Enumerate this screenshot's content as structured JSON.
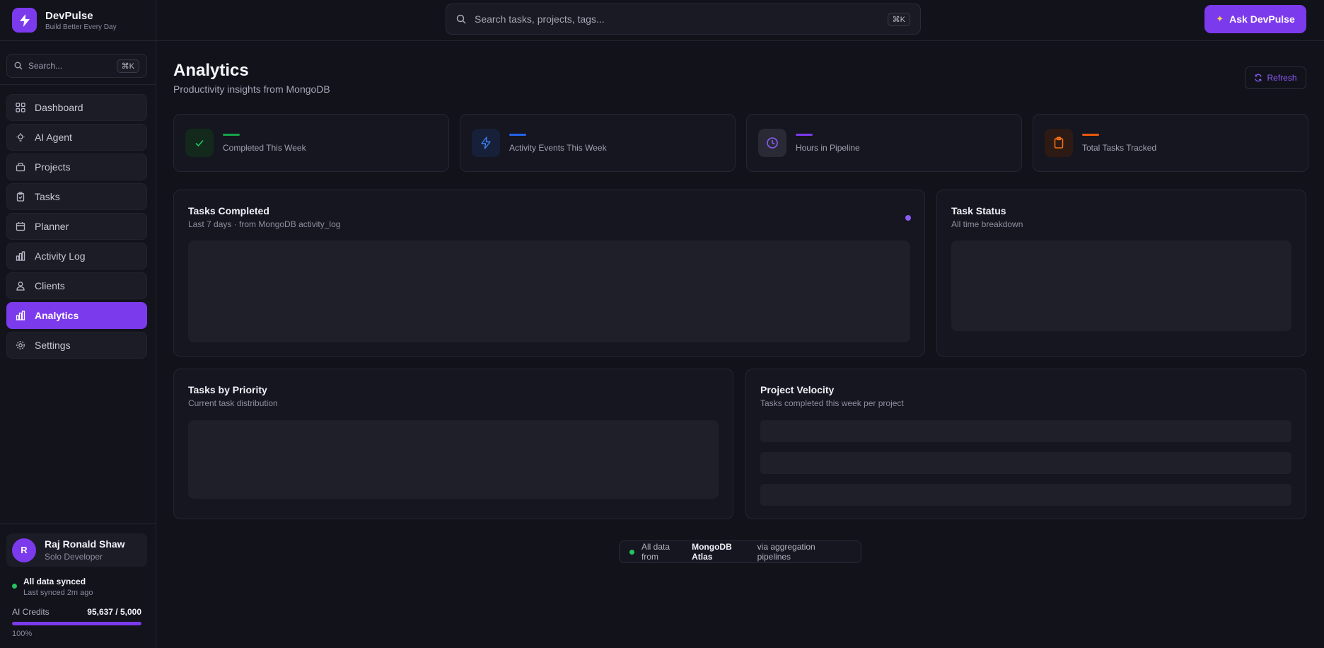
{
  "brand": {
    "name": "DevPulse",
    "tagline": "Build Better Every Day"
  },
  "sidebar": {
    "search_placeholder": "Search...",
    "search_shortcut": "⌘K",
    "items": [
      {
        "label": "Dashboard",
        "icon": "grid-icon"
      },
      {
        "label": "AI Agent",
        "icon": "bulb-icon"
      },
      {
        "label": "Projects",
        "icon": "folder-icon"
      },
      {
        "label": "Tasks",
        "icon": "clipboard-icon"
      },
      {
        "label": "Planner",
        "icon": "calendar-icon"
      },
      {
        "label": "Activity Log",
        "icon": "bar-chart-icon"
      },
      {
        "label": "Clients",
        "icon": "user-icon"
      },
      {
        "label": "Analytics",
        "icon": "bar-chart-icon",
        "active": true
      },
      {
        "label": "Settings",
        "icon": "gear-icon"
      }
    ],
    "user": {
      "initial": "R",
      "name": "Raj Ronald Shaw",
      "role": "Solo Developer"
    },
    "sync": {
      "title": "All data synced",
      "subtitle": "Last synced 2m ago"
    },
    "credits": {
      "label": "AI Credits",
      "value": "95,637 / 5,000",
      "percent_text": "100%",
      "fill_fraction": 1.0
    }
  },
  "topbar": {
    "search_placeholder": "Search tasks, projects, tags...",
    "search_shortcut": "⌘K",
    "ask_label": "Ask DevPulse"
  },
  "main": {
    "title": "Analytics",
    "subtitle": "Productivity insights from MongoDB",
    "refresh_label": "Refresh",
    "stats": [
      {
        "label": "Completed This Week",
        "accent": "#16a34a"
      },
      {
        "label": "Activity Events This Week",
        "accent": "#2563eb"
      },
      {
        "label": "Hours in Pipeline",
        "accent": "#7c3aed"
      },
      {
        "label": "Total Tasks Tracked",
        "accent": "#ea580c"
      }
    ],
    "cards": {
      "tasks_completed": {
        "title": "Tasks Completed",
        "subtitle": "Last 7 days · from MongoDB activity_log"
      },
      "task_status": {
        "title": "Task Status",
        "subtitle": "All time breakdown"
      },
      "tasks_by_priority": {
        "title": "Tasks by Priority",
        "subtitle": "Current task distribution"
      },
      "project_velocity": {
        "title": "Project Velocity",
        "subtitle": "Tasks completed this week per project"
      }
    },
    "footer": {
      "prefix": "All data from",
      "source": "MongoDB Atlas",
      "suffix": "via aggregation pipelines"
    }
  }
}
